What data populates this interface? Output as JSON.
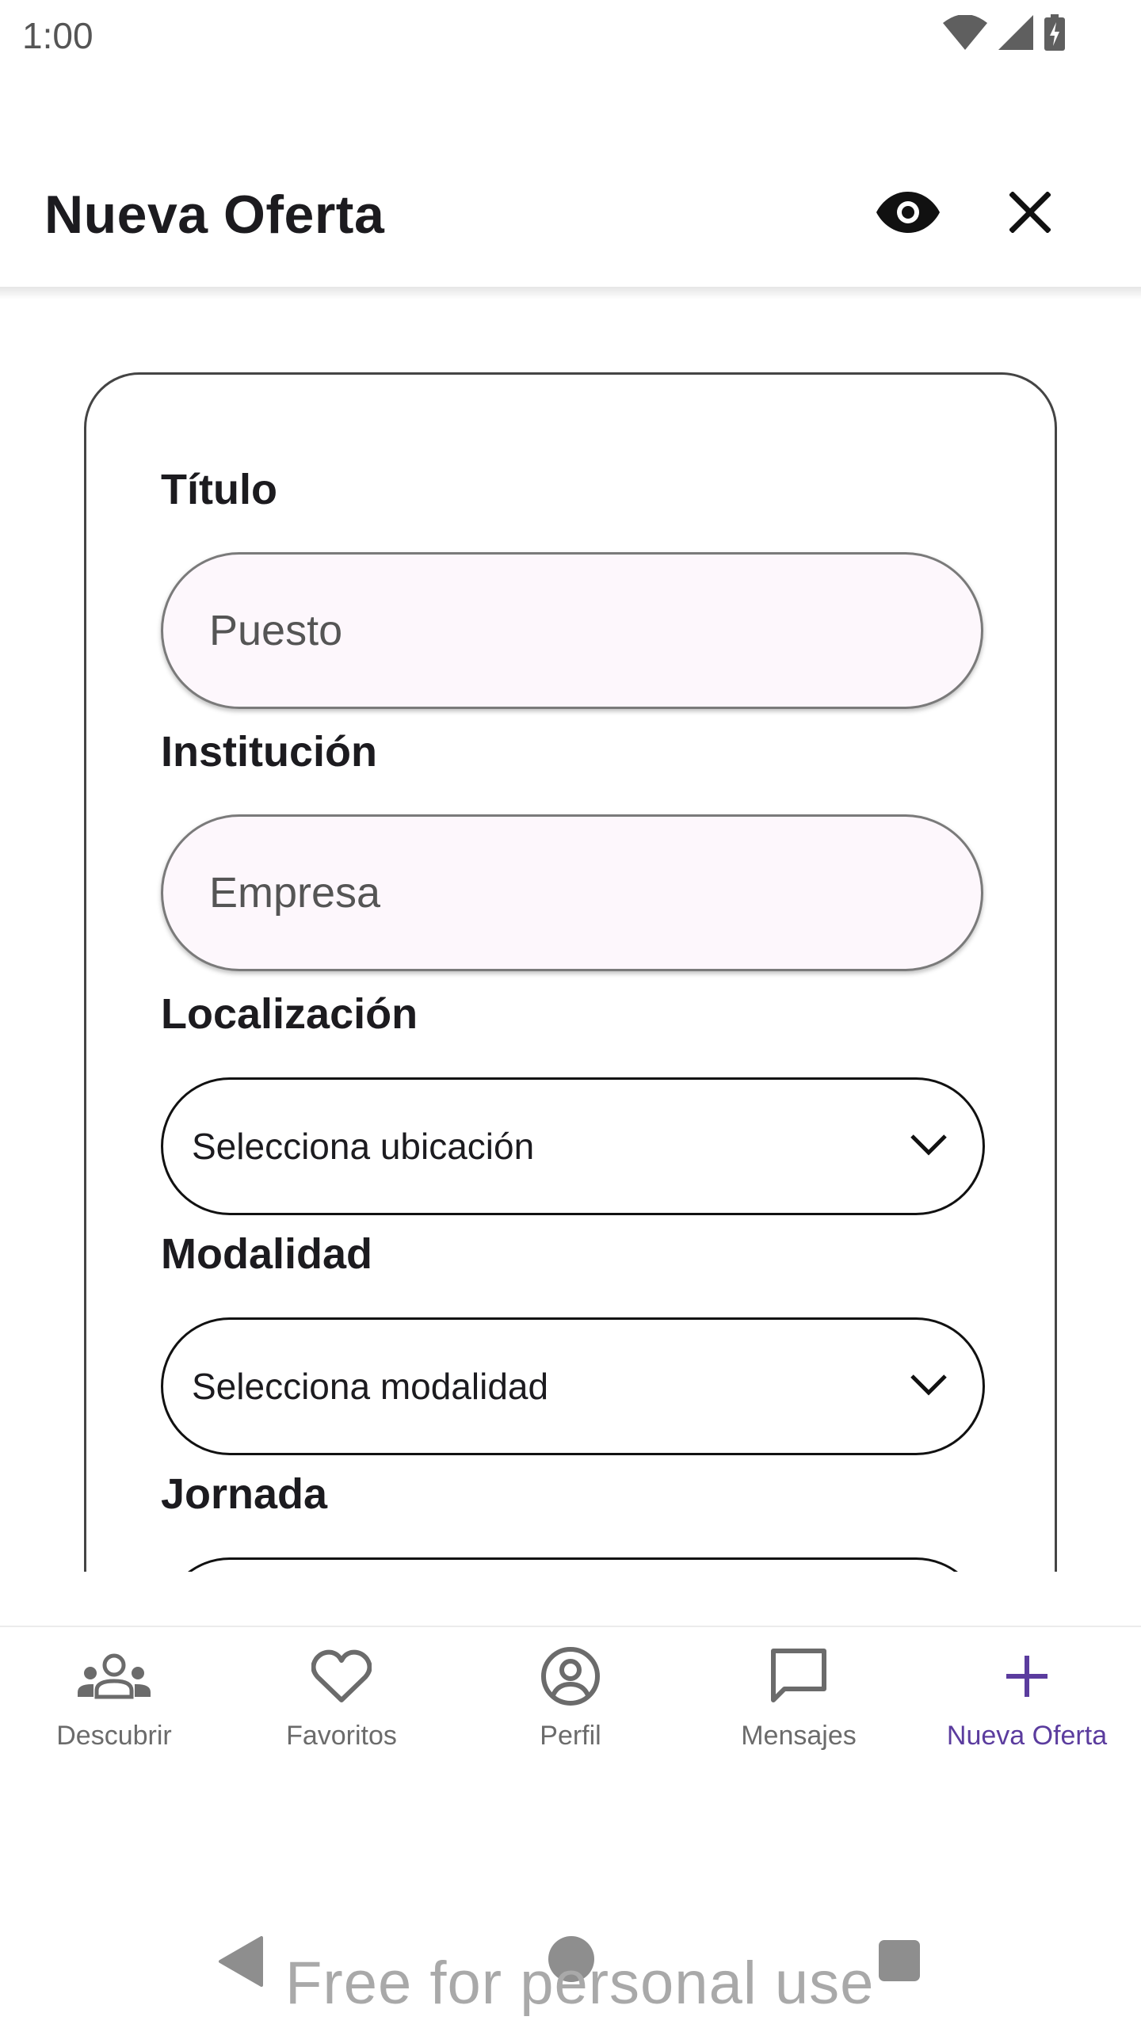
{
  "status_bar": {
    "time": "1:00",
    "icons": [
      "wifi-icon",
      "cellular-signal-icon",
      "battery-charging-icon"
    ]
  },
  "app_bar": {
    "title": "Nueva Oferta",
    "actions": [
      "eye-icon",
      "close-icon"
    ]
  },
  "form": {
    "titulo": {
      "label": "Título",
      "value": "",
      "placeholder": "Puesto"
    },
    "institucion": {
      "label": "Institución",
      "value": "",
      "placeholder": "Empresa"
    },
    "localizacion": {
      "label": "Localización",
      "selected": "Selecciona ubicación"
    },
    "modalidad": {
      "label": "Modalidad",
      "selected": "Selecciona modalidad"
    },
    "jornada": {
      "label": "Jornada"
    }
  },
  "bottom_nav": {
    "items": [
      {
        "label": "Descubrir",
        "icon": "groups-icon",
        "active": false
      },
      {
        "label": "Favoritos",
        "icon": "heart-icon",
        "active": false
      },
      {
        "label": "Perfil",
        "icon": "account-circle-icon",
        "active": false
      },
      {
        "label": "Mensajes",
        "icon": "chat-bubble-icon",
        "active": false
      },
      {
        "label": "Nueva Oferta",
        "icon": "plus-icon",
        "active": true
      }
    ]
  },
  "system_nav": {
    "buttons": [
      "back-icon",
      "home-icon",
      "recents-icon"
    ]
  },
  "watermark": "Free for personal use",
  "colors": {
    "accent": "#5b3c9e",
    "inactive_nav": "#6b6b6b",
    "field_fill": "#fdf7fc"
  }
}
